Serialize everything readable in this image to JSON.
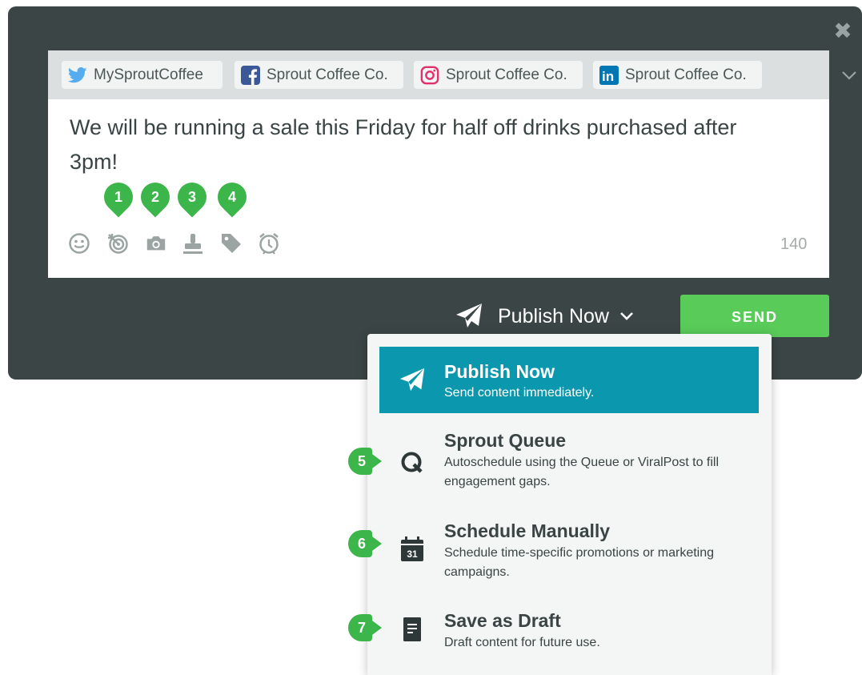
{
  "profiles": [
    {
      "network": "twitter",
      "name": "MySproutCoffee",
      "icon": "twitter-icon",
      "color": "#55acee"
    },
    {
      "network": "facebook",
      "name": "Sprout Coffee Co.",
      "icon": "facebook-icon",
      "color": "#3b5998"
    },
    {
      "network": "instagram",
      "name": "Sprout Coffee Co.",
      "icon": "instagram-icon",
      "color": "#e1306c"
    },
    {
      "network": "linkedin",
      "name": "Sprout Coffee Co.",
      "icon": "linkedin-icon",
      "color": "#0077b5"
    }
  ],
  "message": "We will be running a sale this Friday for half off drinks purchased after 3pm!",
  "char_count": "140",
  "toolbar_icons": [
    "emoji-icon",
    "target-icon",
    "camera-icon",
    "stamp-icon",
    "tag-icon",
    "alarm-icon"
  ],
  "callouts": [
    "1",
    "2",
    "3",
    "4",
    "5",
    "6",
    "7"
  ],
  "publish_mode": "Publish Now",
  "send_label": "SEND",
  "menu": [
    {
      "title": "Publish Now",
      "desc": "Send content immediately.",
      "icon": "paper-plane-icon"
    },
    {
      "title": "Sprout Queue",
      "desc": "Autoschedule using the Queue or ViralPost to fill engagement gaps.",
      "icon": "queue-icon"
    },
    {
      "title": "Schedule Manually",
      "desc": "Schedule time-specific promotions or marketing campaigns.",
      "icon": "calendar-icon"
    },
    {
      "title": "Save as Draft",
      "desc": "Draft content for future use.",
      "icon": "draft-icon"
    }
  ],
  "calendar_day": "31",
  "colors": {
    "panel": "#3b4545",
    "accent": "#0b97ad",
    "send": "#59cb59",
    "callout": "#3cb54a"
  }
}
